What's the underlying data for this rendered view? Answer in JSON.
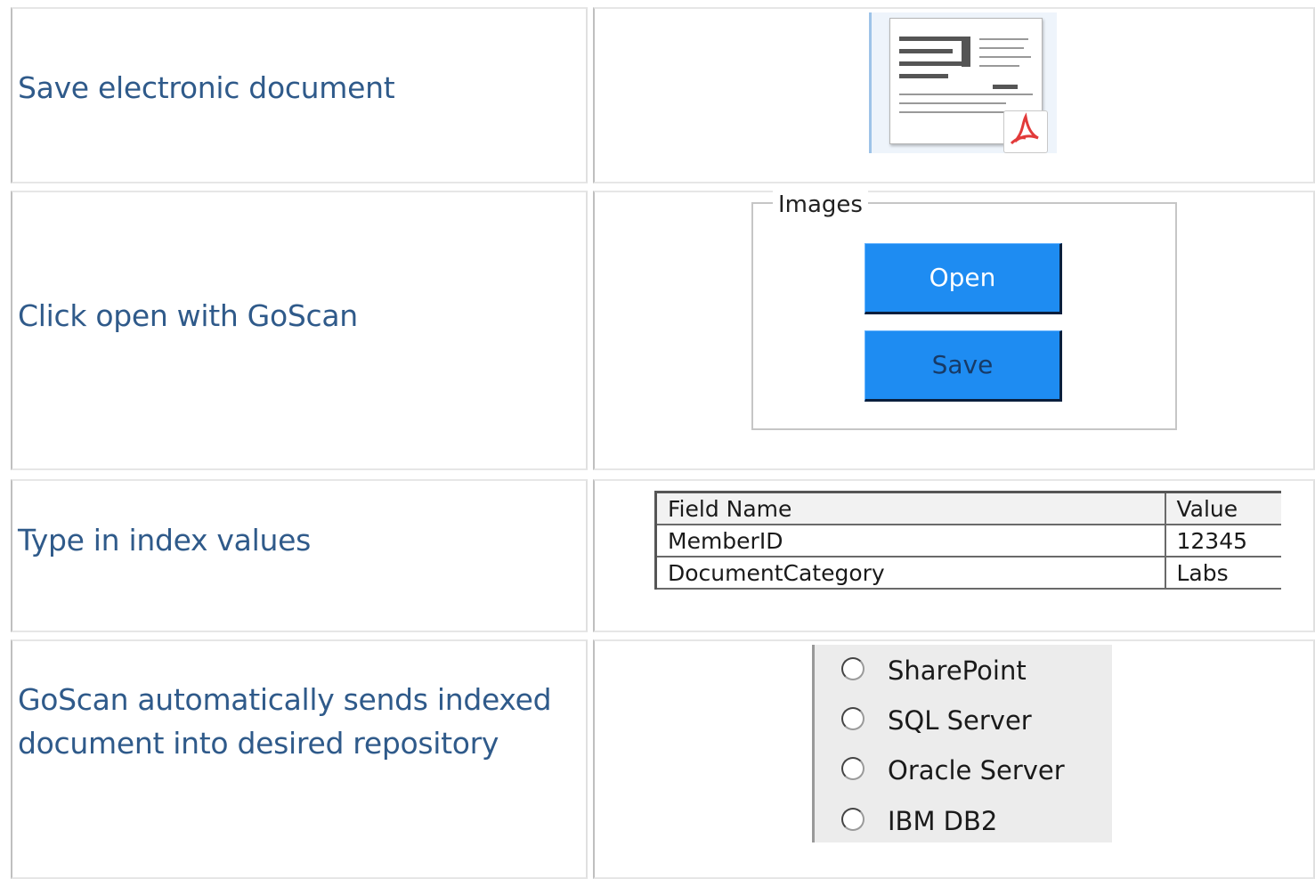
{
  "steps": [
    {
      "label": "Save electronic document"
    },
    {
      "label": "Click open  with GoScan"
    },
    {
      "label": "Type in  index values"
    },
    {
      "label": "GoScan automatically sends indexed document into desired repository"
    }
  ],
  "images_panel": {
    "legend": "Images",
    "open_label": "Open",
    "save_label": "Save"
  },
  "index_grid": {
    "headers": [
      "Field Name",
      "Value"
    ],
    "rows": [
      [
        "MemberID",
        "12345"
      ],
      [
        "DocumentCategory",
        "Labs"
      ]
    ]
  },
  "repositories": [
    {
      "label": "SharePoint"
    },
    {
      "label": "SQL Server"
    },
    {
      "label": "Oracle Server"
    },
    {
      "label": "IBM DB2"
    }
  ],
  "icons": {
    "document": "scanned-document-thumbnail-icon",
    "pdf": "pdf-icon",
    "radio": "radio-button-icon"
  },
  "colors": {
    "step_text": "#2f5a8a",
    "button_fill": "#1e8cf2",
    "pdf_red": "#e23a3a"
  }
}
